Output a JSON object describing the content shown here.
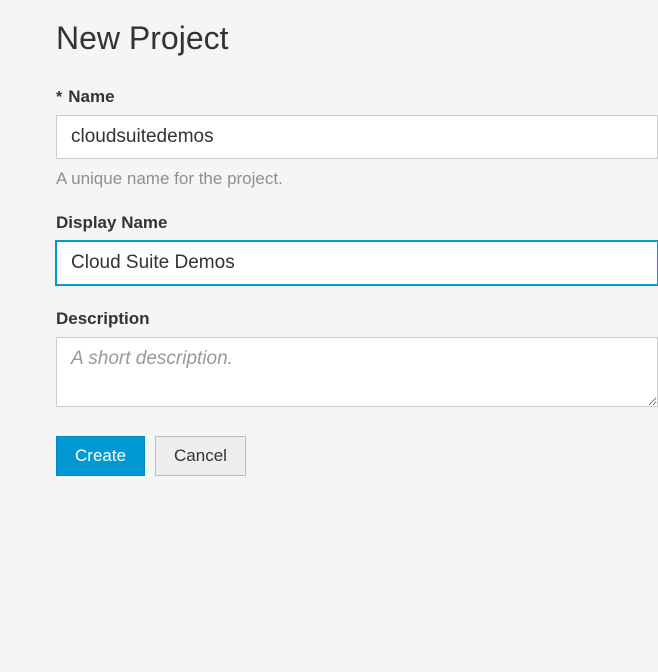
{
  "page": {
    "title": "New Project"
  },
  "form": {
    "name": {
      "label": "Name",
      "required_mark": "*",
      "value": "cloudsuitedemos",
      "help": "A unique name for the project."
    },
    "display_name": {
      "label": "Display Name",
      "value": "Cloud Suite Demos"
    },
    "description": {
      "label": "Description",
      "value": "",
      "placeholder": "A short description."
    }
  },
  "buttons": {
    "create": "Create",
    "cancel": "Cancel"
  }
}
